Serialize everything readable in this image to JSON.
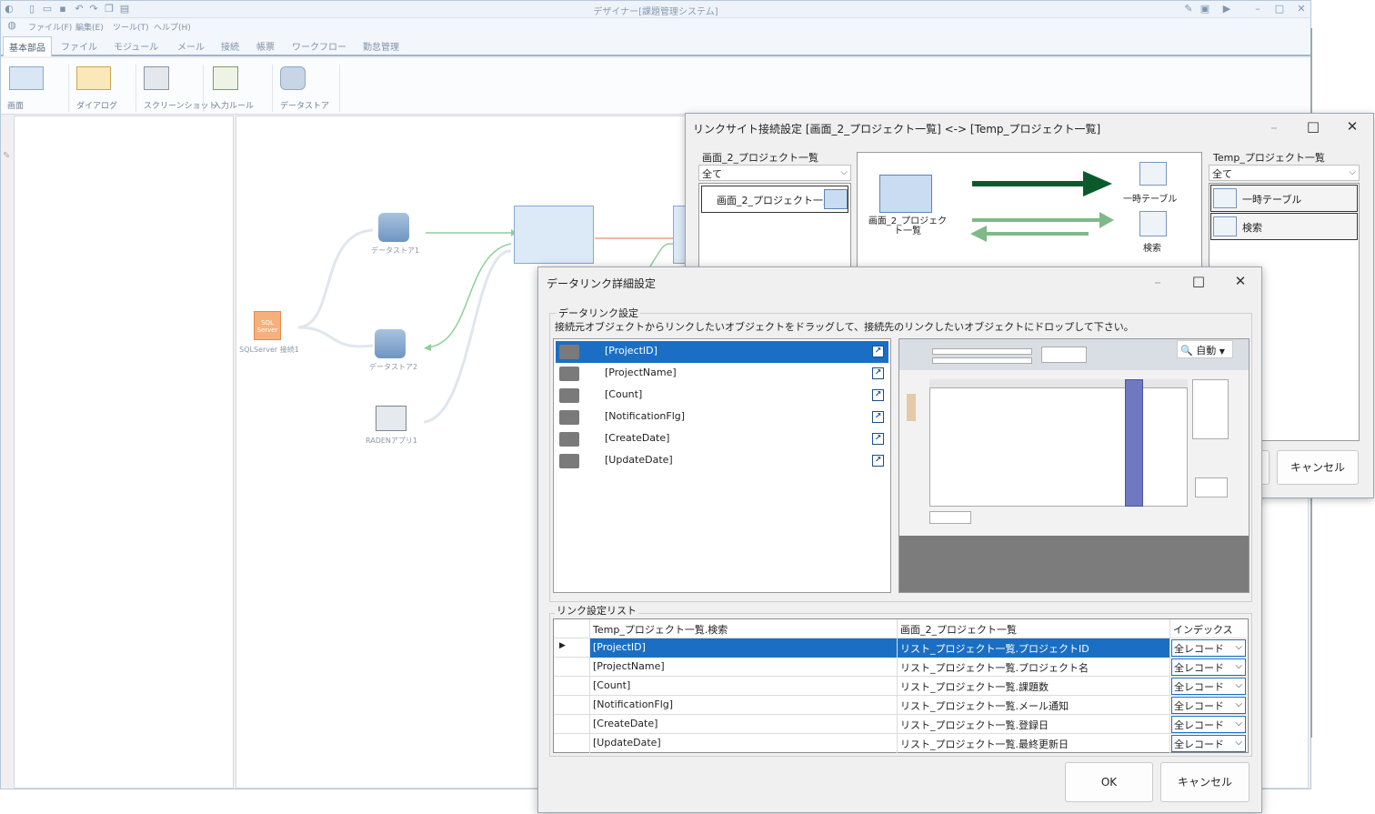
{
  "app": {
    "title": "デザイナー[課題管理システム]",
    "menu": [
      "ファイル(F)",
      "編集(E)",
      "ツール(T)",
      "ヘルプ(H)"
    ],
    "tabs": [
      "基本部品",
      "ファイル",
      "モジュール",
      "メール",
      "接続",
      "帳票",
      "ワークフロー",
      "勤怠管理"
    ],
    "ribbon": [
      "画面",
      "ダイアログ",
      "スクリーンショット",
      "入力ルール",
      "データストア"
    ]
  },
  "canvas": {
    "nodes": {
      "datastore1": "データストア1",
      "datastore2": "データストア2",
      "sqlserver": "SQLServer 接続1",
      "sql_icon": "SQL Server",
      "radenapp": "RADENアプリ1"
    }
  },
  "link_dialog": {
    "title": "リンクサイト接続設定 [画面_2_プロジェクト一覧] <-> [Temp_プロジェクト一覧]",
    "left_group": "画面_2_プロジェクト一覧",
    "left_filter": "全て",
    "left_items": [
      "画面_2_プロジェクト一覧"
    ],
    "diagram_left_label": "画面_2_プロジェクト一覧",
    "diagram_right_top": "一時テーブル",
    "diagram_right_bottom": "検索",
    "right_group": "Temp_プロジェクト一覧",
    "right_filter": "全て",
    "right_items": [
      "一時テーブル",
      "検索"
    ],
    "cancel_label": "キャンセル"
  },
  "detail_dialog": {
    "title": "データリンク詳細設定",
    "section_title": "データリンク設定",
    "instruction": "接続元オブジェクトからリンクしたいオブジェクトをドラッグして、接続先のリンクしたいオブジェクトにドロップして下さい。",
    "fields": [
      "[ProjectID]",
      "[ProjectName]",
      "[Count]",
      "[NotificationFlg]",
      "[CreateDate]",
      "[UpdateDate]"
    ],
    "selected_field": 0,
    "zoom_label": "自動",
    "list_title": "リンク設定リスト",
    "columns": [
      "Temp_プロジェクト一覧.検索",
      "画面_2_プロジェクト一覧",
      "インデックス"
    ],
    "rows": [
      {
        "source": "[ProjectID]",
        "target": "リスト_プロジェクト一覧.プロジェクトID",
        "index": "全レコード"
      },
      {
        "source": "[ProjectName]",
        "target": "リスト_プロジェクト一覧.プロジェクト名",
        "index": "全レコード"
      },
      {
        "source": "[Count]",
        "target": "リスト_プロジェクト一覧.課題数",
        "index": "全レコード"
      },
      {
        "source": "[NotificationFlg]",
        "target": "リスト_プロジェクト一覧.メール通知",
        "index": "全レコード"
      },
      {
        "source": "[CreateDate]",
        "target": "リスト_プロジェクト一覧.登録日",
        "index": "全レコード"
      },
      {
        "source": "[UpdateDate]",
        "target": "リスト_プロジェクト一覧.最終更新日",
        "index": "全レコード"
      }
    ],
    "ok_label": "OK",
    "cancel_label": "キャンセル"
  },
  "colors": {
    "selection": "#1a6fc4",
    "arrow_dark": "#0b5a2c",
    "arrow_light": "#7fb989"
  }
}
